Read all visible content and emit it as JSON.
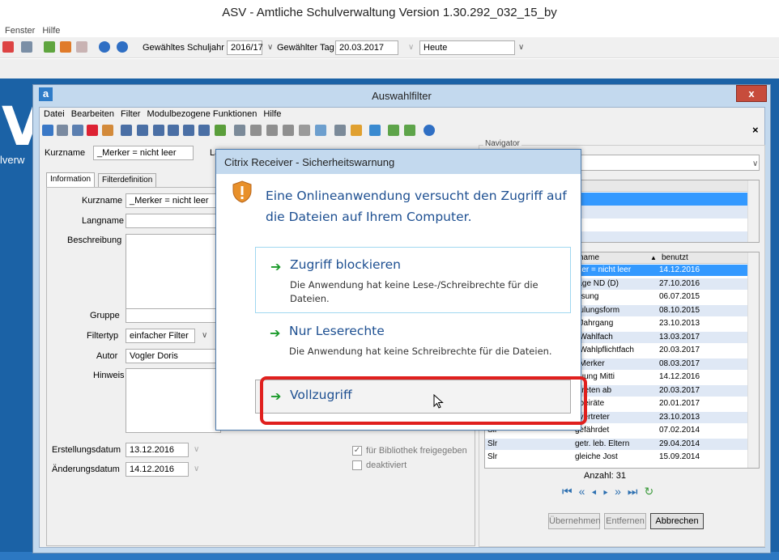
{
  "app": {
    "title": "ASV - Amtliche Schulverwaltung Version 1.30.292_032_15_by",
    "menu": [
      "Fenster",
      "Hilfe"
    ],
    "schuljahr_label": "Gewähltes Schuljahr",
    "schuljahr_value": "2016/17",
    "tag_label": "Gewählter Tag",
    "tag_value": "20.03.2017",
    "heute_value": "Heute"
  },
  "desktop": {
    "big_letter": "V",
    "text": "lverw"
  },
  "dialog": {
    "title": "Auswahlfilter",
    "logo": "a",
    "close": "x",
    "menu": [
      "Datei",
      "Bearbeiten",
      "Filter",
      "Modulbezogene Funktionen",
      "Hilfe"
    ],
    "toolbar_close": "×",
    "kurzname_label": "Kurzname",
    "kurzname_value": "_Merker = nicht leer",
    "langname_short": "La",
    "tabs": [
      "Information",
      "Filterdefinition"
    ],
    "form": {
      "kurzname_label": "Kurzname",
      "kurzname_value": "_Merker = nicht leer",
      "langname_label": "Langname",
      "beschreibung_label": "Beschreibung",
      "gruppe_label": "Gruppe",
      "filtertyp_label": "Filtertyp",
      "filtertyp_value": "einfacher Filter",
      "autor_label": "Autor",
      "autor_value": "Vogler Doris",
      "hinweis_label": "Hinweis",
      "erstellungsdatum_label": "Erstellungsdatum",
      "erstellungsdatum_value": "13.12.2016",
      "aenderungsdatum_label": "Änderungsdatum",
      "aenderungsdatum_value": "14.12.2016",
      "bibliothek_label": "für Bibliothek freigegeben",
      "bibliothek_checked": true,
      "deaktiviert_label": "deaktiviert",
      "deaktiviert_checked": false
    },
    "navigator": {
      "label": "Navigator",
      "columns": [
        "zname",
        "benutzt"
      ],
      "rows": [
        {
          "c1": "",
          "c2": "rker = nicht leer",
          "c3": "14.12.2016",
          "selected": true
        },
        {
          "c1": "",
          "c2": "rage ND (D)",
          "c3": "27.10.2016"
        },
        {
          "c1": "",
          "c2": "eisung",
          "c3": "06.07.2015"
        },
        {
          "c1": "",
          "c2": "hulungsform",
          "c3": "08.10.2015"
        },
        {
          "c1": "",
          "c2": ": Jahrgang",
          "c3": "23.10.2013"
        },
        {
          "c1": "",
          "c2": ": Wahlfach",
          "c3": "13.03.2017"
        },
        {
          "c1": "",
          "c2": ": Wahlpflichtfach",
          "c3": "20.03.2017"
        },
        {
          "c1": "",
          "c2": ". Merker",
          "c3": "08.03.2017"
        },
        {
          "c1": "",
          "c2": "euung Mitti",
          "c3": "14.12.2016"
        },
        {
          "c1": "",
          "c2": "etreten ab",
          "c3": "20.03.2017"
        },
        {
          "c1": "",
          "c2": "nbeiräte",
          "c3": "20.01.2017"
        },
        {
          "c1": "",
          "c2": "nvertreter",
          "c3": "23.10.2013"
        },
        {
          "c1": "Slr",
          "c2": "gefährdet",
          "c3": "07.02.2014"
        },
        {
          "c1": "Slr",
          "c2": "getr. leb. Eltern",
          "c3": "29.04.2014"
        },
        {
          "c1": "Slr",
          "c2": "gleiche Jost",
          "c3": "15.09.2014"
        }
      ],
      "count": "Anzahl: 31",
      "buttons": [
        "Übernehmen",
        "Entfernen",
        "Abbrechen"
      ]
    }
  },
  "citrix": {
    "title": "Citrix Receiver - Sicherheitswarnung",
    "message": "Eine Onlineanwendung versucht den Zugriff auf die Dateien auf Ihrem Computer.",
    "options": [
      {
        "heading": "Zugriff blockieren",
        "desc": "Die Anwendung hat keine Lese-/Schreibrechte für die Dateien."
      },
      {
        "heading": "Nur Leserechte",
        "desc": "Die Anwendung hat keine Schreibrechte für die Dateien."
      },
      {
        "heading": "Vollzugriff",
        "desc": ""
      }
    ]
  },
  "colors": {
    "accent": "#1d4f91",
    "highlight": "#e0201e",
    "selection": "#3399ff"
  }
}
